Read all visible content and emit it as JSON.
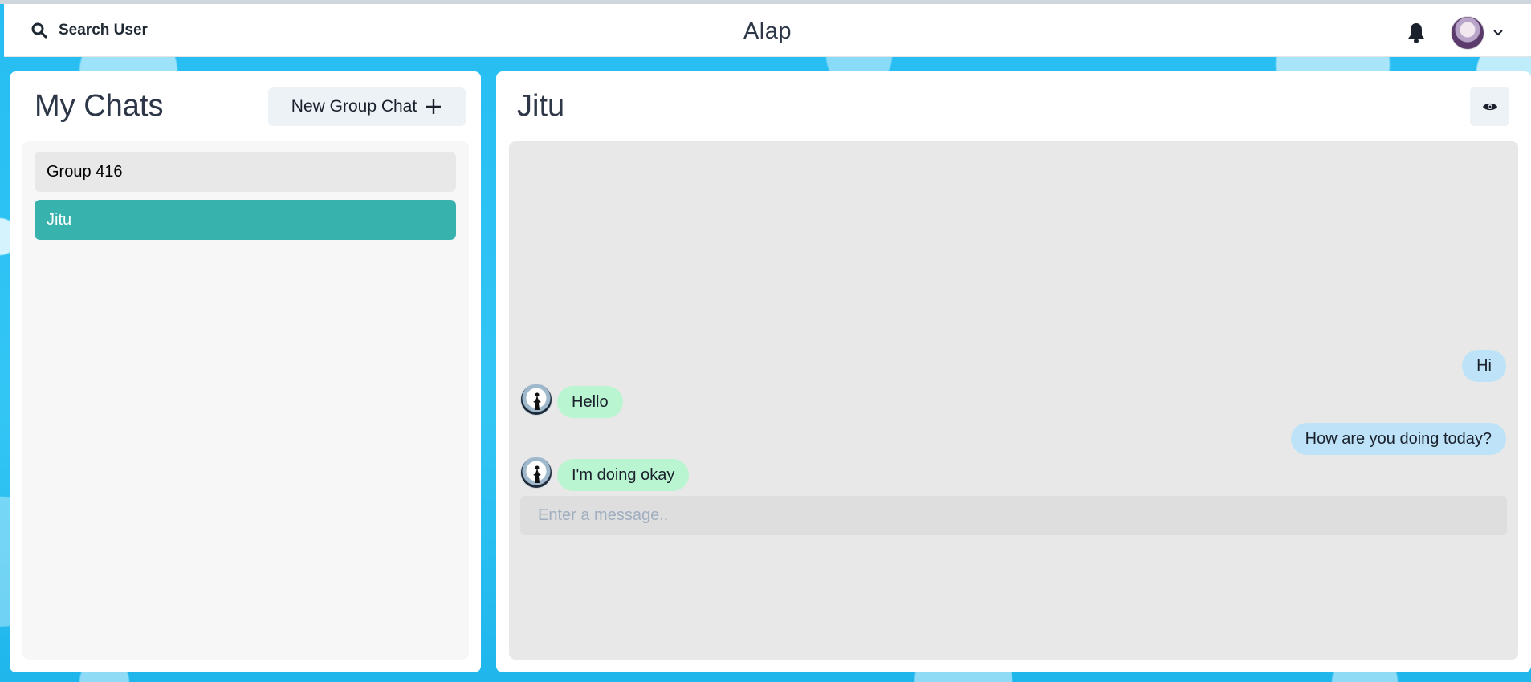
{
  "header": {
    "search_label": "Search User",
    "app_title": "Alap",
    "icons": {
      "search": "search-icon",
      "bell": "bell-icon",
      "chevron": "chevron-down-icon"
    }
  },
  "sidebar": {
    "title": "My Chats",
    "new_group_label": "New Group Chat",
    "chats": [
      {
        "name": "Group 416",
        "active": false
      },
      {
        "name": "Jitu",
        "active": true
      }
    ]
  },
  "conversation": {
    "title": "Jitu",
    "messages": [
      {
        "text": "Hi",
        "from": "me"
      },
      {
        "text": "Hello",
        "from": "other"
      },
      {
        "text": "How are you doing today?",
        "from": "me"
      },
      {
        "text": "I'm doing okay",
        "from": "other"
      }
    ],
    "input_placeholder": "Enter a message..",
    "input_value": ""
  },
  "colors": {
    "background": "#2cc3f4",
    "active_chat": "#38b2ac",
    "sent_bubble": "#bee3f8",
    "received_bubble": "#b9f5d0"
  }
}
